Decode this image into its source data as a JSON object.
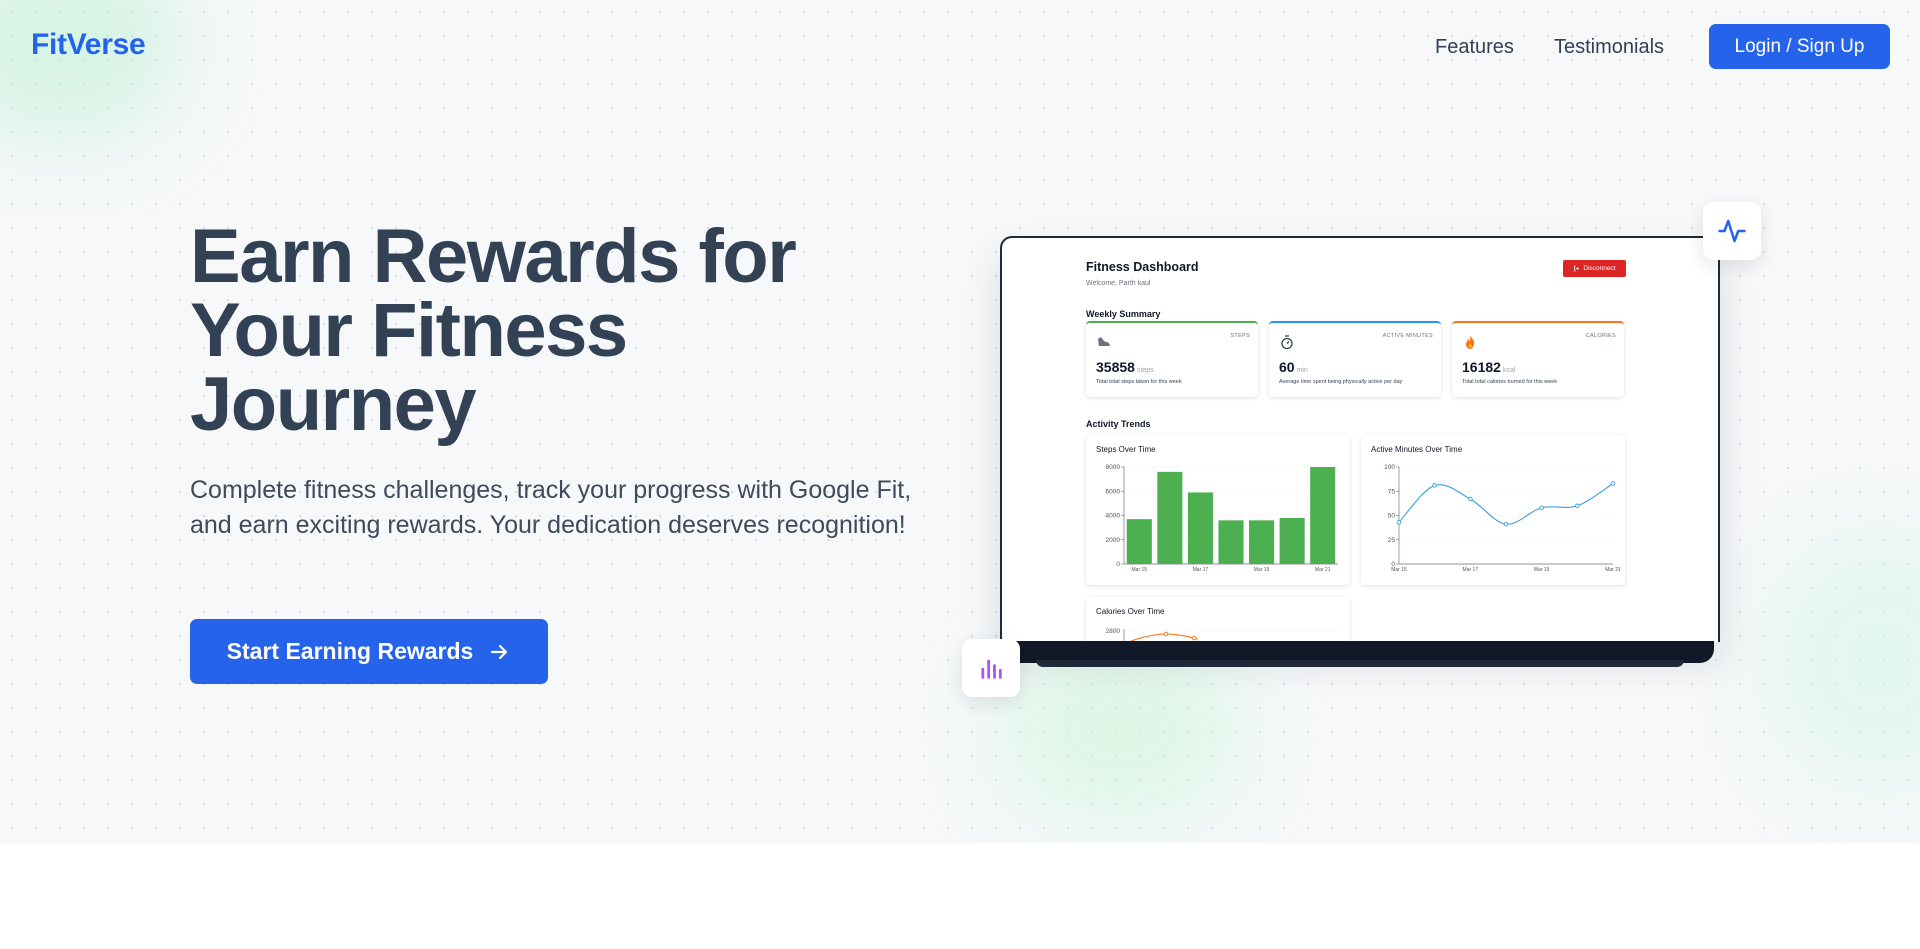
{
  "brand": {
    "logo_text": "FitVerse",
    "accent": "#2563eb"
  },
  "nav": {
    "features": "Features",
    "testimonials": "Testimonials",
    "login": "Login / Sign Up"
  },
  "hero": {
    "headline": "Earn Rewards for Your Fitness Journey",
    "subtext": "Complete fitness challenges, track your progress with Google Fit, and earn exciting rewards. Your dedication deserves recognition!",
    "cta": "Start Earning Rewards",
    "cta_icon": "arrow-right-icon"
  },
  "dashboard": {
    "title": "Fitness Dashboard",
    "welcome": "Welcome, Parth kaul",
    "disconnect": "Disconnect",
    "weekly_title": "Weekly Summary",
    "stats": {
      "steps": {
        "label": "STEPS",
        "value": "35858",
        "unit": "steps",
        "desc": "Total total steps taken for this week",
        "icon": "shoe-icon",
        "color": "#4caf50"
      },
      "active": {
        "label": "ACTIVE MINUTES",
        "value": "60",
        "unit": "min",
        "desc": "Average time spent being physically active per day",
        "icon": "stopwatch-icon",
        "color": "#2196f3"
      },
      "calories": {
        "label": "CALORIES",
        "value": "16182",
        "unit": "kcal",
        "desc": "Total total calories burned for this week",
        "icon": "flame-icon",
        "color": "#f97316"
      }
    },
    "trends_title": "Activity Trends",
    "charts": {
      "steps_title": "Steps Over Time",
      "active_title": "Active Minutes Over Time",
      "calories_title": "Calories Over Time"
    }
  },
  "chart_data": [
    {
      "type": "bar",
      "title": "Steps Over Time",
      "categories": [
        "Mar 15",
        "Mar 16",
        "Mar 17",
        "Mar 18",
        "Mar 19",
        "Mar 20",
        "Mar 21"
      ],
      "x_tick_labels": [
        "Mar 15",
        "Mar 17",
        "Mar 19",
        "Mar 21"
      ],
      "values": [
        3700,
        7600,
        5900,
        3600,
        3600,
        3800,
        8000
      ],
      "ylim": [
        0,
        8000
      ],
      "y_ticks": [
        0,
        2000,
        4000,
        6000,
        8000
      ],
      "color": "#4caf50"
    },
    {
      "type": "line",
      "title": "Active Minutes Over Time",
      "categories": [
        "Mar 15",
        "Mar 16",
        "Mar 17",
        "Mar 18",
        "Mar 19",
        "Mar 20",
        "Mar 21"
      ],
      "x_tick_labels": [
        "Mar 15",
        "Mar 17",
        "Mar 19",
        "Mar 21"
      ],
      "values": [
        43,
        81,
        67,
        41,
        58,
        60,
        83
      ],
      "ylim": [
        0,
        100
      ],
      "y_ticks": [
        0,
        25,
        50,
        75,
        100
      ],
      "color": "#3b9fe0"
    },
    {
      "type": "line",
      "title": "Calories Over Time",
      "y_ticks": [
        2800
      ],
      "color": "#f97316"
    }
  ]
}
